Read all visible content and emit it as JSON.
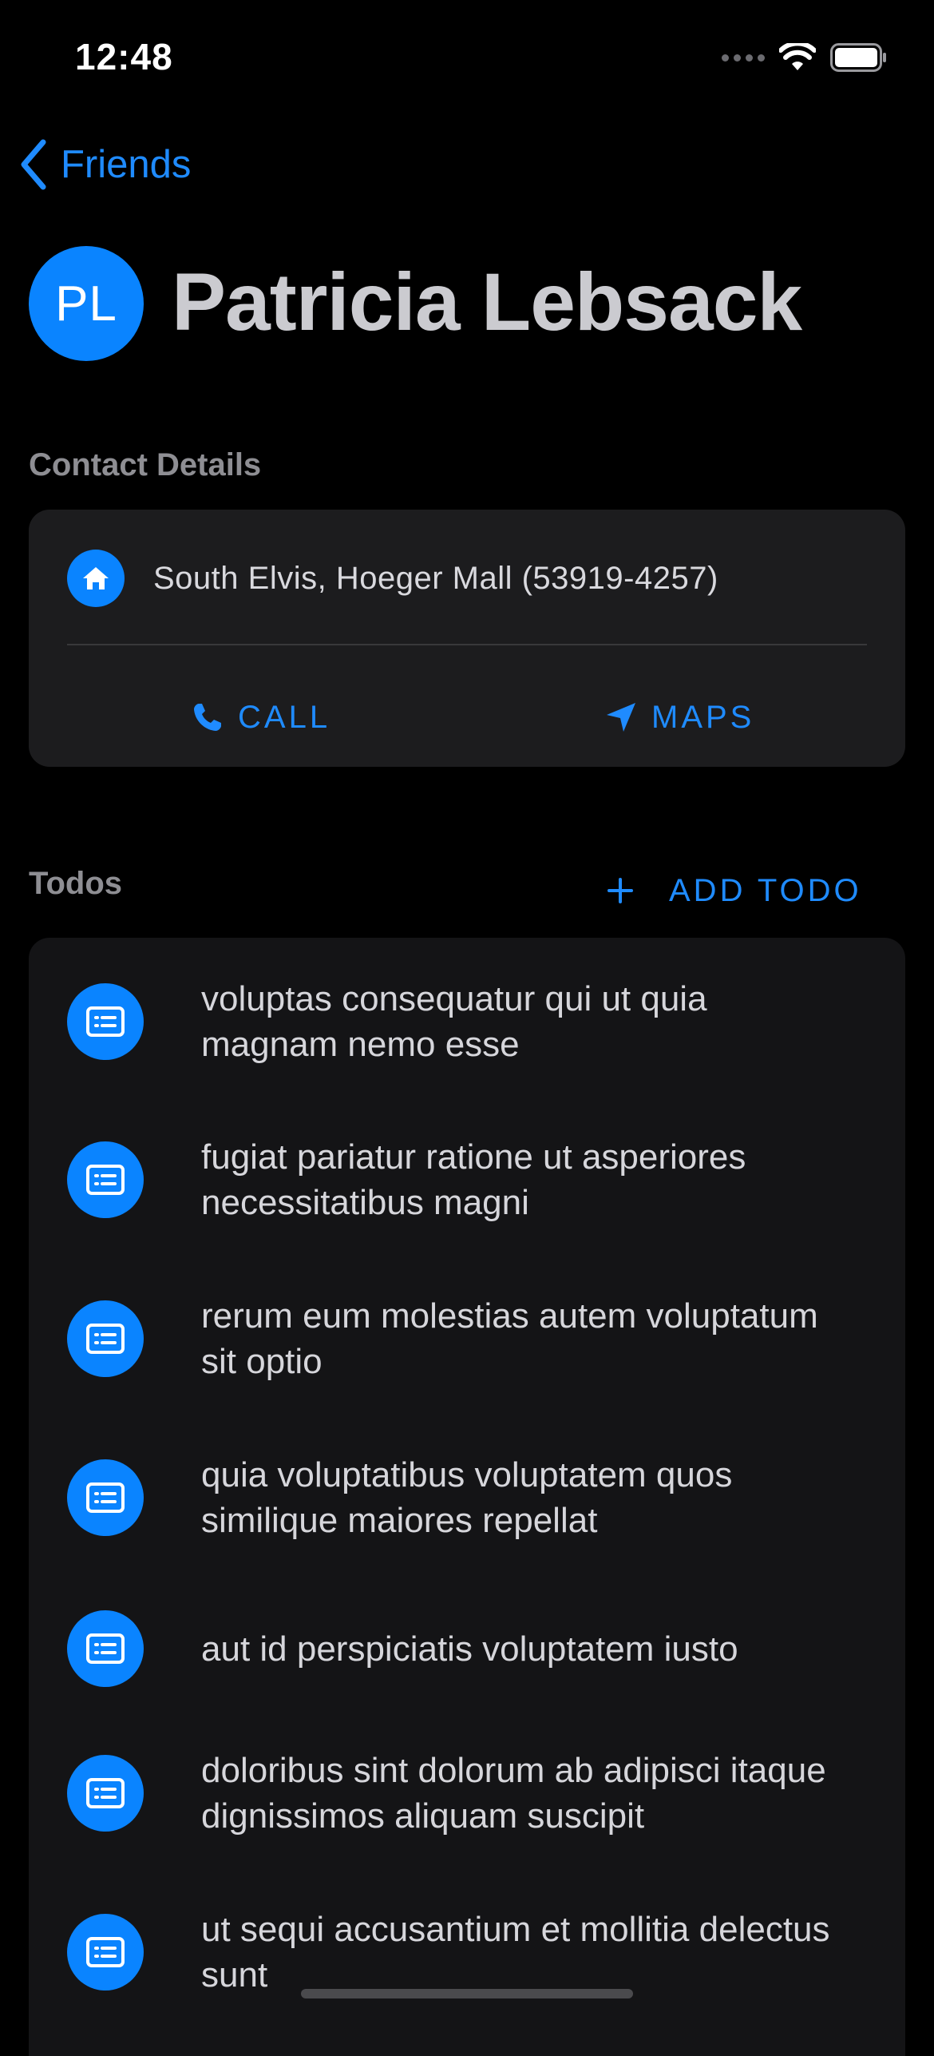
{
  "status_bar": {
    "time": "12:48"
  },
  "nav": {
    "back_label": "Friends"
  },
  "header": {
    "initials": "PL",
    "name": "Patricia Lebsack"
  },
  "contact": {
    "section_title": "Contact Details",
    "address": "South Elvis, Hoeger Mall (53919-4257)",
    "call_label": "CALL",
    "maps_label": "MAPS"
  },
  "todos": {
    "section_title": "Todos",
    "add_label": "ADD TODO",
    "items": [
      {
        "title": "voluptas consequatur qui ut quia magnam nemo esse"
      },
      {
        "title": "fugiat pariatur ratione ut asperiores necessitatibus magni"
      },
      {
        "title": "rerum eum molestias autem voluptatum sit optio"
      },
      {
        "title": "quia voluptatibus voluptatem quos similique maiores repellat"
      },
      {
        "title": "aut id perspiciatis voluptatem iusto"
      },
      {
        "title": "doloribus sint dolorum ab adipisci itaque dignissimos aliquam suscipit"
      },
      {
        "title": "ut sequi accusantium et mollitia delectus sunt"
      }
    ]
  },
  "theme": {
    "accent": "#0a84ff",
    "background": "#000000",
    "card": "#1c1c1e"
  },
  "icons": {
    "back": "chevron-left-icon",
    "home": "house-icon",
    "call": "phone-icon",
    "maps": "location-arrow-icon",
    "add": "plus-icon",
    "todo": "list-card-icon"
  }
}
